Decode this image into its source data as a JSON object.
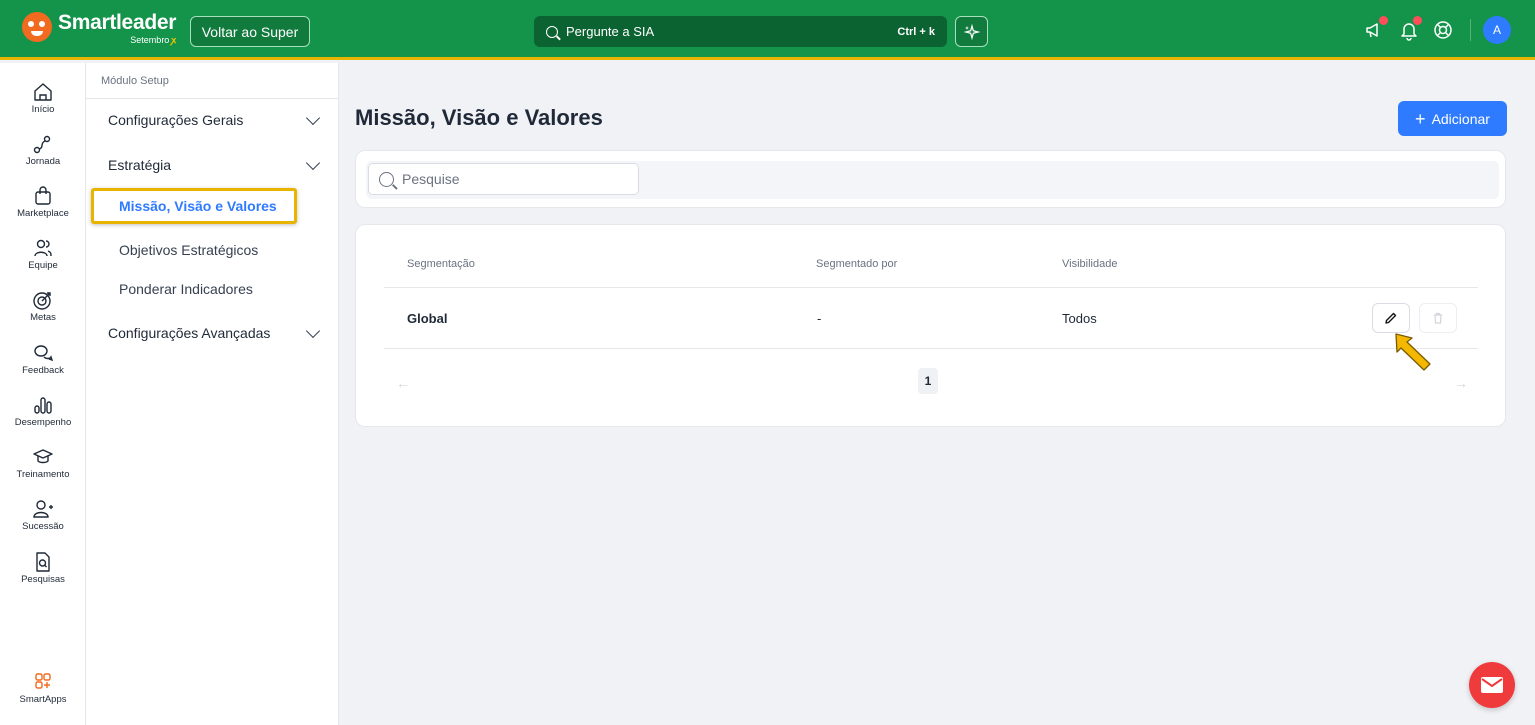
{
  "brand": {
    "name": "Smartleader",
    "subtitle": "Setembro",
    "ribbon": "🎗"
  },
  "header": {
    "back_button": "Voltar ao Super",
    "search_label": "Pergunte a SIA",
    "search_shortcut": "Ctrl + k",
    "avatar_initial": "A"
  },
  "rail": {
    "items": [
      {
        "label": "Início",
        "icon": "home-icon"
      },
      {
        "label": "Jornada",
        "icon": "journey-icon"
      },
      {
        "label": "Marketplace",
        "icon": "shopping-bag-icon"
      },
      {
        "label": "Equipe",
        "icon": "team-icon"
      },
      {
        "label": "Metas",
        "icon": "target-icon"
      },
      {
        "label": "Feedback",
        "icon": "chat-bubbles-icon"
      },
      {
        "label": "Desempenho",
        "icon": "bar-chart-icon"
      },
      {
        "label": "Treinamento",
        "icon": "graduation-cap-icon"
      },
      {
        "label": "Sucessão",
        "icon": "user-plus-icon"
      },
      {
        "label": "Pesquisas",
        "icon": "survey-icon"
      }
    ],
    "smartapps_label": "SmartApps"
  },
  "setup_menu": {
    "title": "Módulo Setup",
    "groups": [
      {
        "label": "Configurações Gerais"
      },
      {
        "label": "Estratégia"
      },
      {
        "label": "Configurações Avançadas"
      }
    ],
    "strategy_items": [
      {
        "label": "Missão, Visão e Valores",
        "active": true
      },
      {
        "label": "Objetivos Estratégicos"
      },
      {
        "label": "Ponderar Indicadores"
      }
    ]
  },
  "main": {
    "title": "Missão, Visão e Valores",
    "add_button": "Adicionar",
    "search_placeholder": "Pesquise",
    "table": {
      "headers": [
        "Segmentação",
        "Segmentado por",
        "Visibilidade"
      ],
      "rows": [
        {
          "segmentacao": "Global",
          "segmentado_por": "-",
          "visibilidade": "Todos"
        }
      ]
    },
    "pagination": {
      "current_page": "1",
      "prev": "←",
      "next": "→"
    }
  },
  "colors": {
    "topbar": "#14934a",
    "accent_yellow": "#e8b400",
    "primary_blue": "#2f7bff",
    "chat_red": "#ef3b3b"
  }
}
